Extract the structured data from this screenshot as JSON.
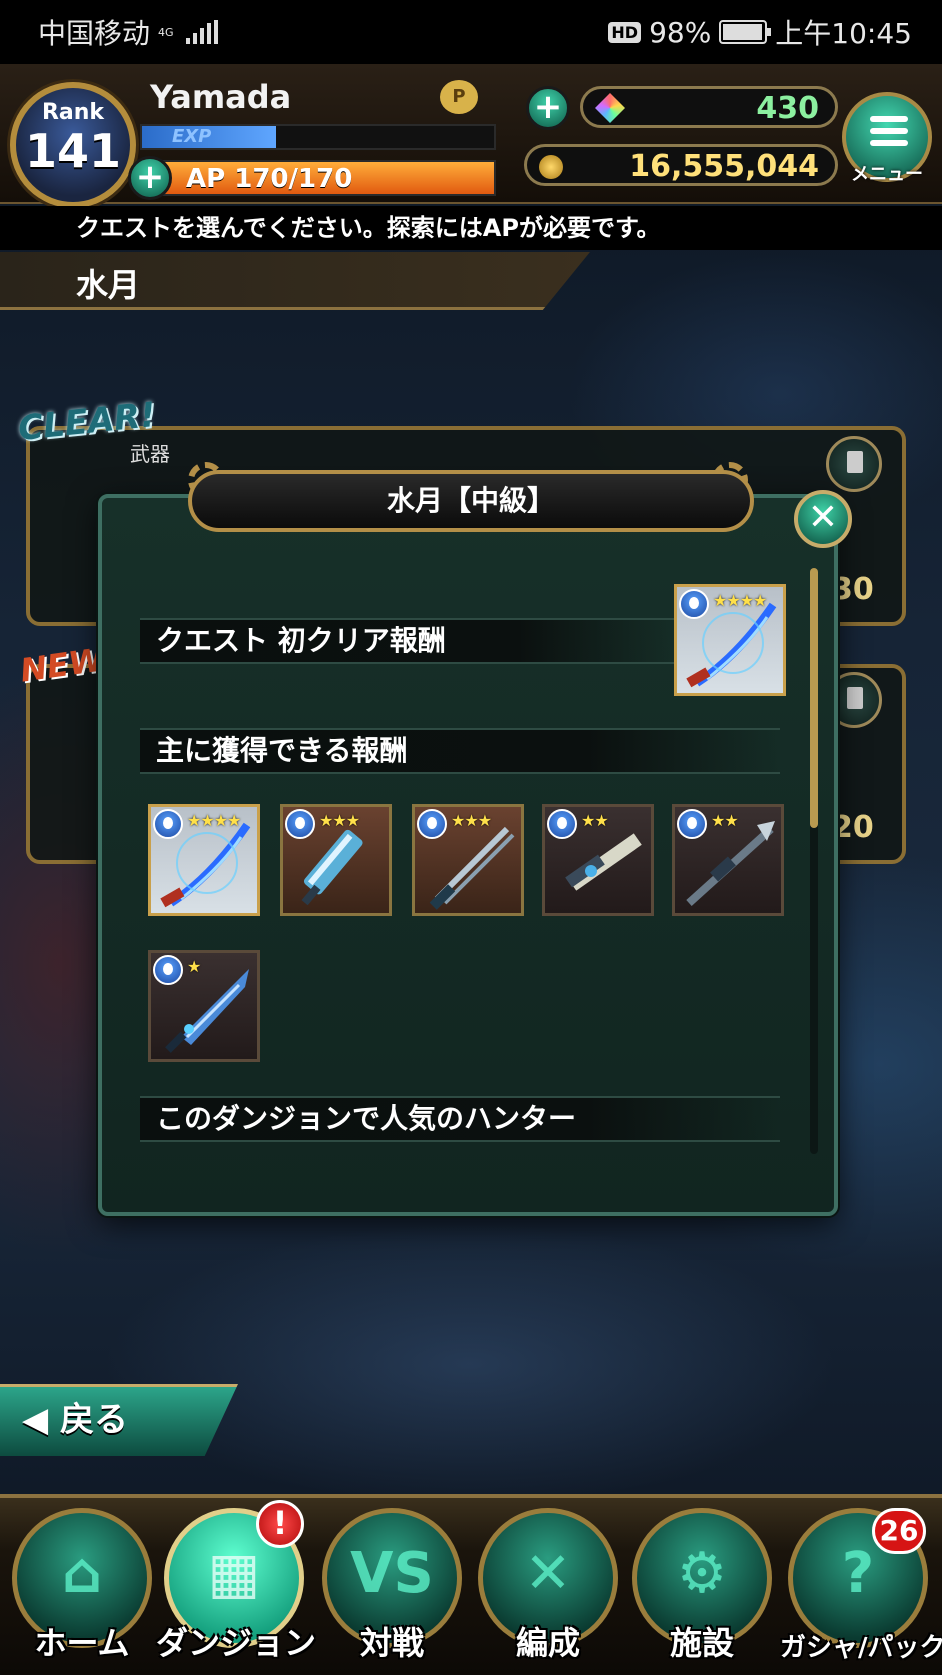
{
  "status_bar": {
    "carrier": "中国移动",
    "network": "4G",
    "battery": "98%",
    "time": "上午10:45"
  },
  "player": {
    "rank_label": "Rank",
    "rank": "141",
    "name": "Yamada",
    "exp_label": "EXP",
    "exp_fraction": 0.38,
    "ap_label": "AP",
    "ap_value": "170/170",
    "ap_fraction": 1.0
  },
  "currency": {
    "gems": "430",
    "gold": "16,555,044"
  },
  "menu_label": "メニュー",
  "message": "クエストを選んでください。探索にはAPが必要です。",
  "area_title": "水月",
  "background_cards": {
    "clear_badge": "CLEAR!",
    "new_badge": "NEW",
    "weapon_tag": "武器",
    "card1_number": "30",
    "card2_number": "20"
  },
  "modal": {
    "title": "水月【中級】",
    "close_glyph": "✕",
    "first_clear_header": "クエスト 初クリア報酬",
    "rewards_header": "主に獲得できる報酬",
    "popular_header": "このダンジョンで人気のハンター",
    "first_clear_reward": {
      "stars": "★★★★",
      "icon": "blue-scimitar-icon"
    },
    "rewards": [
      {
        "stars": "★★★★",
        "icon": "blue-scimitar-icon"
      },
      {
        "stars": "★★★",
        "icon": "chainsaw-sword-icon"
      },
      {
        "stars": "★★★",
        "icon": "twin-blade-icon"
      },
      {
        "stars": "★★",
        "icon": "gun-blade-icon"
      },
      {
        "stars": "★★",
        "icon": "halberd-gun-icon"
      },
      {
        "stars": "★",
        "icon": "broadsword-icon"
      }
    ]
  },
  "back_button": "戻る",
  "nav": [
    {
      "label": "ホーム",
      "icon": "home-icon",
      "glyph": "⌂"
    },
    {
      "label": "ダンジョン",
      "icon": "dungeon-icon",
      "glyph": "▦"
    },
    {
      "label": "対戦",
      "icon": "versus-icon",
      "glyph": "VS"
    },
    {
      "label": "編成",
      "icon": "party-icon",
      "glyph": "✕"
    },
    {
      "label": "施設",
      "icon": "facility-gear-icon",
      "glyph": "⚙"
    },
    {
      "label": "ガシャ/パック",
      "icon": "gacha-icon",
      "glyph": "?"
    }
  ],
  "nav_alert": "!",
  "nav_gacha_count": "26"
}
